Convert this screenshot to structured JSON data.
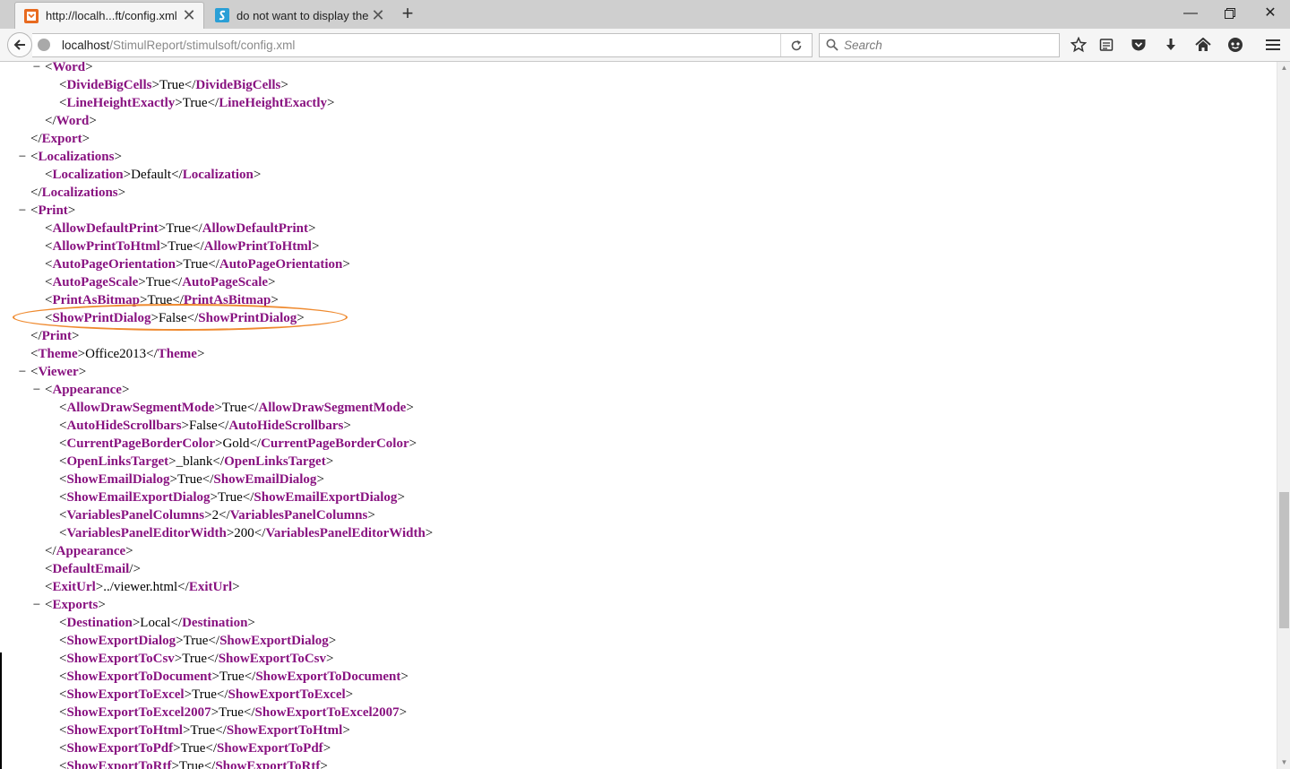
{
  "tabs": [
    {
      "title": "http://localh...ft/config.xml",
      "active": true,
      "favicon": "xml-file-icon"
    },
    {
      "title": "do not want to display the...",
      "active": false,
      "favicon": "stimulsoft-icon"
    }
  ],
  "navbar": {
    "url_host": "localhost",
    "url_path": "/StimulReport/stimulsoft/config.xml",
    "search_placeholder": "Search",
    "toolbar_icons": [
      "bookmark-star-icon",
      "reading-list-icon",
      "pocket-icon",
      "downloads-icon",
      "home-icon",
      "chat-icon",
      "menu-icon"
    ]
  },
  "window_controls": [
    "minimize-icon",
    "restore-icon",
    "close-icon"
  ],
  "colors": {
    "tag": "#881280",
    "highlight": "#ef8a2f"
  },
  "xml_lines": [
    {
      "indent": 3,
      "toggle": true,
      "kind": "open",
      "tag": "Word"
    },
    {
      "indent": 4,
      "kind": "elem",
      "tag": "DivideBigCells",
      "value": "True"
    },
    {
      "indent": 4,
      "kind": "elem",
      "tag": "LineHeightExactly",
      "value": "True"
    },
    {
      "indent": 3,
      "kind": "close",
      "tag": "Word"
    },
    {
      "indent": 2,
      "kind": "close",
      "tag": "Export"
    },
    {
      "indent": 2,
      "toggle": true,
      "kind": "open",
      "tag": "Localizations"
    },
    {
      "indent": 3,
      "kind": "elem",
      "tag": "Localization",
      "value": "Default"
    },
    {
      "indent": 2,
      "kind": "close",
      "tag": "Localizations"
    },
    {
      "indent": 2,
      "toggle": true,
      "kind": "open",
      "tag": "Print"
    },
    {
      "indent": 3,
      "kind": "elem",
      "tag": "AllowDefaultPrint",
      "value": "True"
    },
    {
      "indent": 3,
      "kind": "elem",
      "tag": "AllowPrintToHtml",
      "value": "True"
    },
    {
      "indent": 3,
      "kind": "elem",
      "tag": "AutoPageOrientation",
      "value": "True"
    },
    {
      "indent": 3,
      "kind": "elem",
      "tag": "AutoPageScale",
      "value": "True"
    },
    {
      "indent": 3,
      "kind": "elem",
      "tag": "PrintAsBitmap",
      "value": "True"
    },
    {
      "indent": 3,
      "kind": "elem",
      "tag": "ShowPrintDialog",
      "value": "False"
    },
    {
      "indent": 2,
      "kind": "close",
      "tag": "Print"
    },
    {
      "indent": 2,
      "kind": "elem",
      "tag": "Theme",
      "value": "Office2013"
    },
    {
      "indent": 2,
      "toggle": true,
      "kind": "open",
      "tag": "Viewer"
    },
    {
      "indent": 3,
      "toggle": true,
      "kind": "open",
      "tag": "Appearance"
    },
    {
      "indent": 4,
      "kind": "elem",
      "tag": "AllowDrawSegmentMode",
      "value": "True"
    },
    {
      "indent": 4,
      "kind": "elem",
      "tag": "AutoHideScrollbars",
      "value": "False"
    },
    {
      "indent": 4,
      "kind": "elem",
      "tag": "CurrentPageBorderColor",
      "value": "Gold"
    },
    {
      "indent": 4,
      "kind": "elem",
      "tag": "OpenLinksTarget",
      "value": "_blank"
    },
    {
      "indent": 4,
      "kind": "elem",
      "tag": "ShowEmailDialog",
      "value": "True"
    },
    {
      "indent": 4,
      "kind": "elem",
      "tag": "ShowEmailExportDialog",
      "value": "True"
    },
    {
      "indent": 4,
      "kind": "elem",
      "tag": "VariablesPanelColumns",
      "value": "2"
    },
    {
      "indent": 4,
      "kind": "elem",
      "tag": "VariablesPanelEditorWidth",
      "value": "200"
    },
    {
      "indent": 3,
      "kind": "close",
      "tag": "Appearance"
    },
    {
      "indent": 3,
      "kind": "empty",
      "tag": "DefaultEmail"
    },
    {
      "indent": 3,
      "kind": "elem",
      "tag": "ExitUrl",
      "value": "../viewer.html"
    },
    {
      "indent": 3,
      "toggle": true,
      "kind": "open",
      "tag": "Exports"
    },
    {
      "indent": 4,
      "kind": "elem",
      "tag": "Destination",
      "value": "Local"
    },
    {
      "indent": 4,
      "kind": "elem",
      "tag": "ShowExportDialog",
      "value": "True"
    },
    {
      "indent": 4,
      "kind": "elem",
      "tag": "ShowExportToCsv",
      "value": "True"
    },
    {
      "indent": 4,
      "kind": "elem",
      "tag": "ShowExportToDocument",
      "value": "True"
    },
    {
      "indent": 4,
      "kind": "elem",
      "tag": "ShowExportToExcel",
      "value": "True"
    },
    {
      "indent": 4,
      "kind": "elem",
      "tag": "ShowExportToExcel2007",
      "value": "True"
    },
    {
      "indent": 4,
      "kind": "elem",
      "tag": "ShowExportToHtml",
      "value": "True"
    },
    {
      "indent": 4,
      "kind": "elem",
      "tag": "ShowExportToPdf",
      "value": "True"
    },
    {
      "indent": 4,
      "kind": "elem",
      "tag": "ShowExportToRtf",
      "value": "True"
    }
  ],
  "highlighted_line_index": 14
}
